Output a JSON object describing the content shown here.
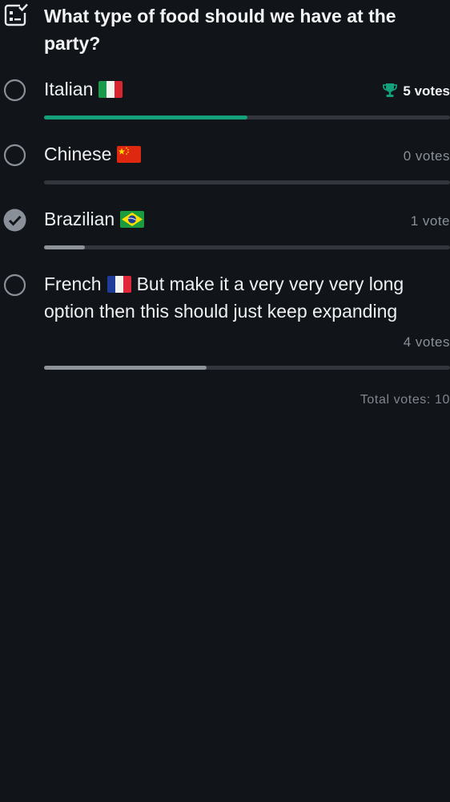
{
  "poll": {
    "question": "What type of food should we have at the party?",
    "icon": "poll-checklist-icon",
    "total_votes_label": "Total votes: 10"
  },
  "colors": {
    "background": "#111418",
    "winner_bar": "#13a07a",
    "normal_bar": "#8e9399",
    "track": "#33373d",
    "trophy": "#13a07a"
  },
  "options": [
    {
      "label": "Italian",
      "flag": "italy-flag-icon",
      "votes_label": "5 votes",
      "votes": 5,
      "share": 0.5,
      "winner": true,
      "selected": false
    },
    {
      "label": "Chinese",
      "flag": "china-flag-icon",
      "votes_label": "0 votes",
      "votes": 0,
      "share": 0,
      "winner": false,
      "selected": false
    },
    {
      "label": "Brazilian",
      "flag": "brazil-flag-icon",
      "votes_label": "1 vote",
      "votes": 1,
      "share": 0.1,
      "winner": false,
      "selected": true
    },
    {
      "label_before_flag": "French",
      "label_after_flag": "But make it a very very very long option then this should just keep expanding",
      "flag": "france-flag-icon",
      "votes_label": "4 votes",
      "votes": 4,
      "share": 0.4,
      "winner": false,
      "selected": false
    }
  ]
}
